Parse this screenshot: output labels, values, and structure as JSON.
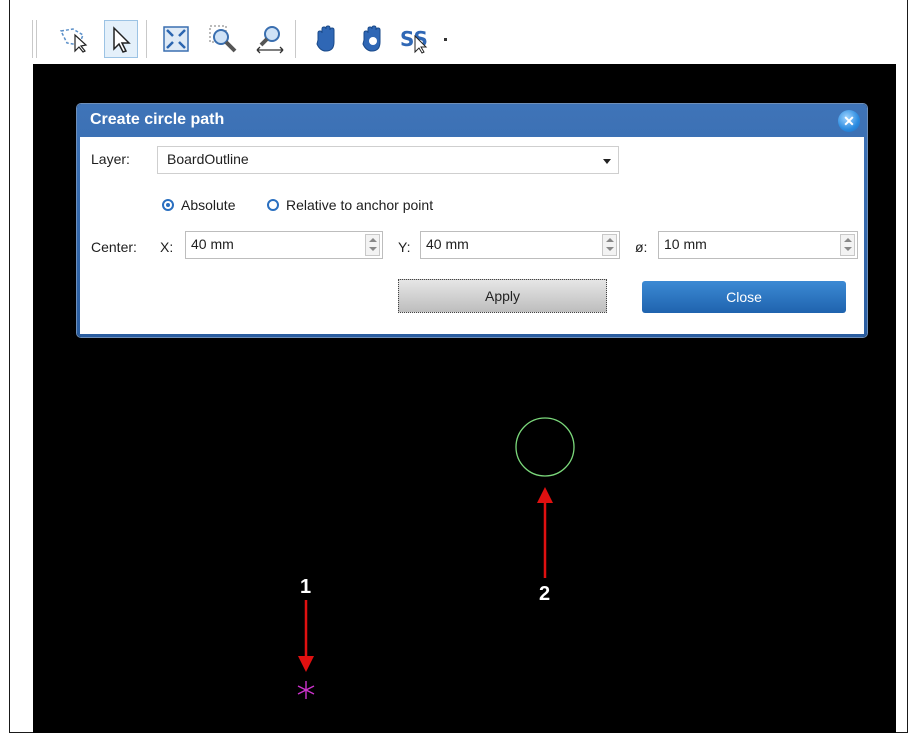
{
  "toolbar": {
    "icons": [
      "lasso-select-icon",
      "pointer-select-icon",
      "zoom-fit-icon",
      "zoom-window-icon",
      "zoom-width-icon",
      "pan-icon",
      "pan-drag-icon",
      "snap-icon"
    ]
  },
  "dialog": {
    "title": "Create circle path",
    "layer_label": "Layer:",
    "layer_value": "BoardOutline",
    "radio_absolute": "Absolute",
    "radio_relative": "Relative to anchor point",
    "center_label": "Center:",
    "x_label": "X:",
    "x_value": "40 mm",
    "y_label": "Y:",
    "y_value": "40 mm",
    "diameter_label": "ø:",
    "diameter_value": "10 mm",
    "apply_label": "Apply",
    "close_label": "Close"
  },
  "annotations": {
    "one": "1",
    "two": "2"
  },
  "colors": {
    "circle": "#7bd87b",
    "anchor": "#cc33cc",
    "arrow": "#e01010"
  }
}
